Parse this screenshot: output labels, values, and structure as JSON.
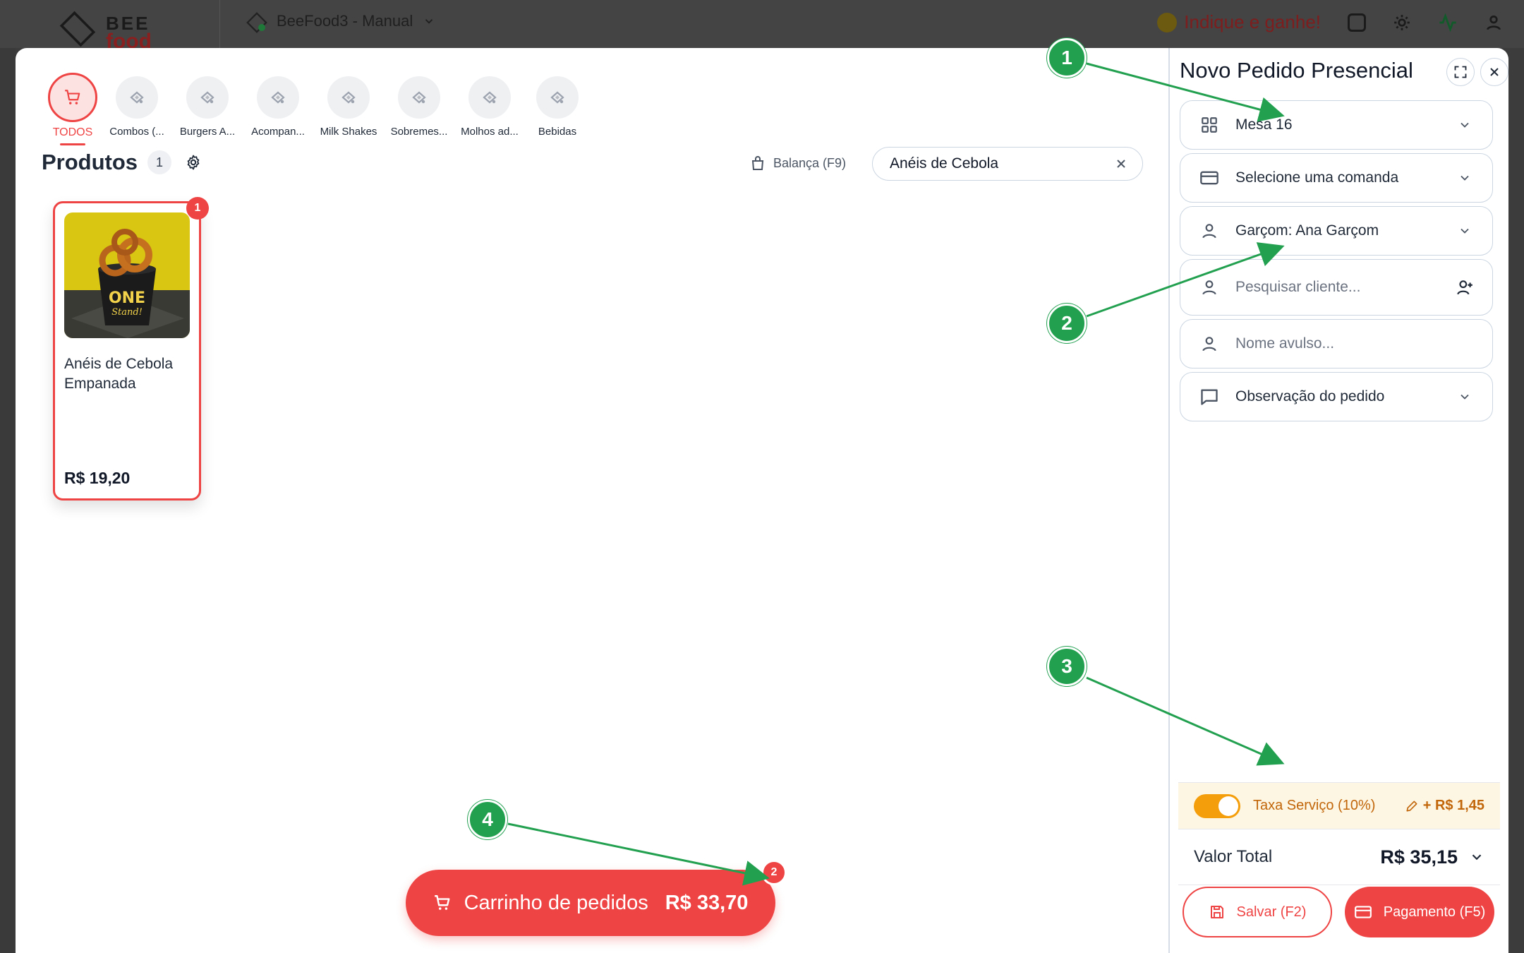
{
  "background": {
    "logo_top": "BEE",
    "logo_bottom": "food",
    "store_name": "BeeFood3 - Manual",
    "indique": "Indique e ganhe!"
  },
  "categories": [
    {
      "label": "TODOS",
      "active": true
    },
    {
      "label": "Combos (...",
      "active": false
    },
    {
      "label": "Burgers A...",
      "active": false
    },
    {
      "label": "Acompan...",
      "active": false
    },
    {
      "label": "Milk Shakes",
      "active": false
    },
    {
      "label": "Sobremes...",
      "active": false
    },
    {
      "label": "Molhos ad...",
      "active": false
    },
    {
      "label": "Bebidas",
      "active": false
    }
  ],
  "products": {
    "title": "Produtos",
    "count": "1",
    "balanca": "Balança (F9)",
    "search_value": "Anéis de Cebola",
    "items": [
      {
        "name": "Anéis de Cebola Empanada",
        "price": "R$ 19,20",
        "qty": "1"
      }
    ]
  },
  "cart": {
    "label": "Carrinho de pedidos",
    "total": "R$ 33,70",
    "badge": "2"
  },
  "order": {
    "title": "Novo Pedido Presencial",
    "mesa": "Mesa 16",
    "comanda": "Selecione uma comanda",
    "garcom": "Garçom: Ana Garçom",
    "cliente_placeholder": "Pesquisar cliente...",
    "avulso_placeholder": "Nome avulso...",
    "observacao": "Observação do pedido",
    "taxa_label": "Taxa Serviço (10%)",
    "taxa_value": "+ R$ 1,45",
    "taxa_enabled": true,
    "total_label": "Valor Total",
    "total_value": "R$ 35,15",
    "save_label": "Salvar (F2)",
    "pay_label": "Pagamento (F5)"
  },
  "annotations": [
    "1",
    "2",
    "3",
    "4"
  ],
  "colors": {
    "accent": "#ef4444",
    "annotation": "#22a050",
    "taxa": "#f59e0b"
  }
}
